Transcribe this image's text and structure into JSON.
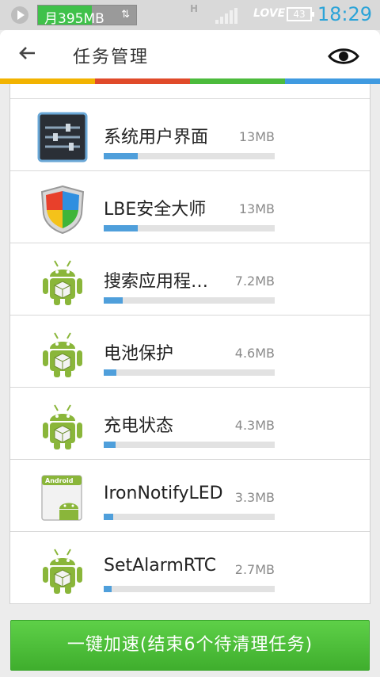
{
  "status_bar": {
    "memory_label": "月395MB",
    "memory_fill_fraction": 0.55,
    "h_indicator": "H",
    "carrier_text": "LOVE",
    "battery_level": "43",
    "time": "18:29"
  },
  "header": {
    "title": "任务管理",
    "back_icon": "arrow-left-icon",
    "view_icon": "eye-icon"
  },
  "color_stripe": [
    "#f2b300",
    "#e04a2a",
    "#4cbb3c",
    "#3f9ae0"
  ],
  "tasks": [
    {
      "name": "系统用户界面",
      "size": "13MB",
      "usage_fraction": 0.2,
      "icon": "system-ui-sliders-icon"
    },
    {
      "name": "LBE安全大师",
      "size": "13MB",
      "usage_fraction": 0.2,
      "icon": "lbe-shield-icon"
    },
    {
      "name": "搜索应用程…",
      "size": "7.2MB",
      "usage_fraction": 0.11,
      "icon": "android-robot-icon"
    },
    {
      "name": "电池保护",
      "size": "4.6MB",
      "usage_fraction": 0.075,
      "icon": "android-robot-icon"
    },
    {
      "name": "充电状态",
      "size": "4.3MB",
      "usage_fraction": 0.07,
      "icon": "android-robot-icon"
    },
    {
      "name": "IronNotifyLED",
      "size": "3.3MB",
      "usage_fraction": 0.055,
      "icon": "android-card-icon"
    },
    {
      "name": "SetAlarmRTC",
      "size": "2.7MB",
      "usage_fraction": 0.045,
      "icon": "android-robot-icon"
    }
  ],
  "android_card_label": "Android",
  "action_button_label": "一键加速(结束6个待清理任务)"
}
